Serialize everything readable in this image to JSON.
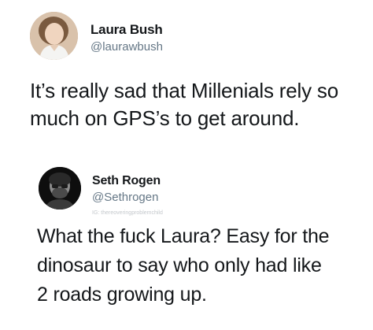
{
  "tweets": [
    {
      "author": {
        "name": "Laura Bush",
        "handle": "@laurawbush",
        "avatar_icon": "profile-photo-woman"
      },
      "text": "It’s really sad that Millenials rely so\nmuch on GPS’s to get around."
    },
    {
      "author": {
        "name": "Seth Rogen",
        "handle": "@Sethrogen",
        "avatar_icon": "profile-photo-man-bw"
      },
      "watermark": "IG: thereoveringproblemchild",
      "text": "What the fuck Laura? Easy for the\ndinosaur to say who only had like\n2 roads growing up."
    }
  ]
}
